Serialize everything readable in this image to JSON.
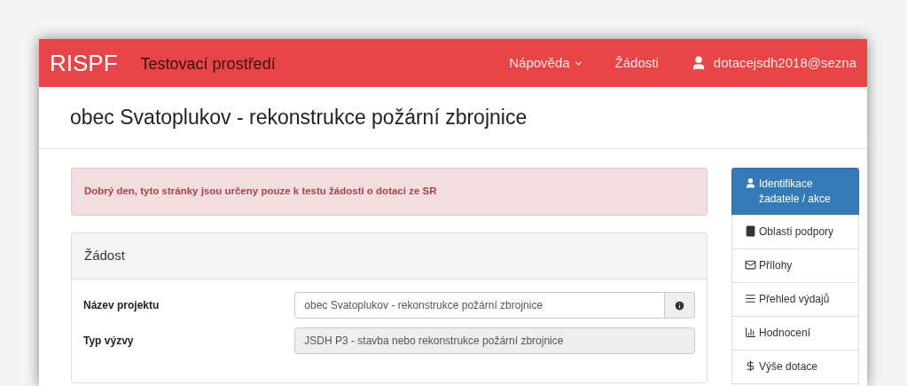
{
  "navbar": {
    "brand": "RISPF",
    "environment": "Testovací prostředí",
    "items": [
      {
        "label": "Nápověda",
        "kind": "dropdown"
      },
      {
        "label": "Žádosti",
        "kind": "link"
      }
    ],
    "user": "dotacejsdh2018@sezna"
  },
  "page": {
    "title": "obec Svatoplukov - rekonstrukce požární zbrojnice"
  },
  "alert": "Dobrý den, tyto stránky jsou určeny pouze k testu žádosti o dotaci ze SR",
  "panel": {
    "title": "Žádost",
    "fields": [
      {
        "label": "Název projektu",
        "value": "obec Svatoplukov - rekonstrukce požární zbrojnice",
        "disabled": false,
        "info": true
      },
      {
        "label": "Typ výzvy",
        "value": "JSDH P3 - stavba nebo rekonstrukce požární zbrojnice",
        "disabled": true,
        "info": false
      }
    ]
  },
  "sidebar": {
    "items": [
      {
        "label": "Identifikace žadatele / akce",
        "kind": "user",
        "selected": true
      },
      {
        "label": "Oblasti podpory",
        "kind": "book",
        "selected": false
      },
      {
        "label": "Přílohy",
        "kind": "envelope",
        "selected": false
      },
      {
        "label": "Přehled výdajů",
        "kind": "list",
        "selected": false
      },
      {
        "label": "Hodnocení",
        "kind": "signal",
        "selected": false
      },
      {
        "label": "Výše dotace",
        "kind": "dollar",
        "selected": false
      }
    ]
  }
}
